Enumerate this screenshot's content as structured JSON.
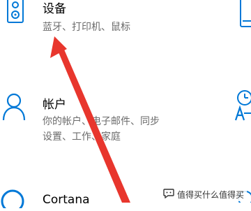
{
  "tiles": [
    {
      "title": "设备",
      "description": "蓝牙、打印机、鼠标",
      "icon": "devices-icon"
    },
    {
      "title": "帐户",
      "description_lines": [
        "你的帐户、电子邮件、同步",
        "设置、工作、家庭"
      ],
      "icon": "person-icon"
    },
    {
      "title": "Cortana",
      "icon": "cortana-icon"
    }
  ],
  "right_icons": [
    "phone-icon",
    "time-language-icon",
    "ease-of-access-icon"
  ],
  "annotation": {
    "arrow_color": "#e8362d"
  },
  "watermark": {
    "text": "值得买什么值得买",
    "icon": "chat-bubble-icon"
  },
  "colors": {
    "accent": "#0078d7",
    "text": "#000000",
    "secondary_text": "#6b6b6b"
  }
}
